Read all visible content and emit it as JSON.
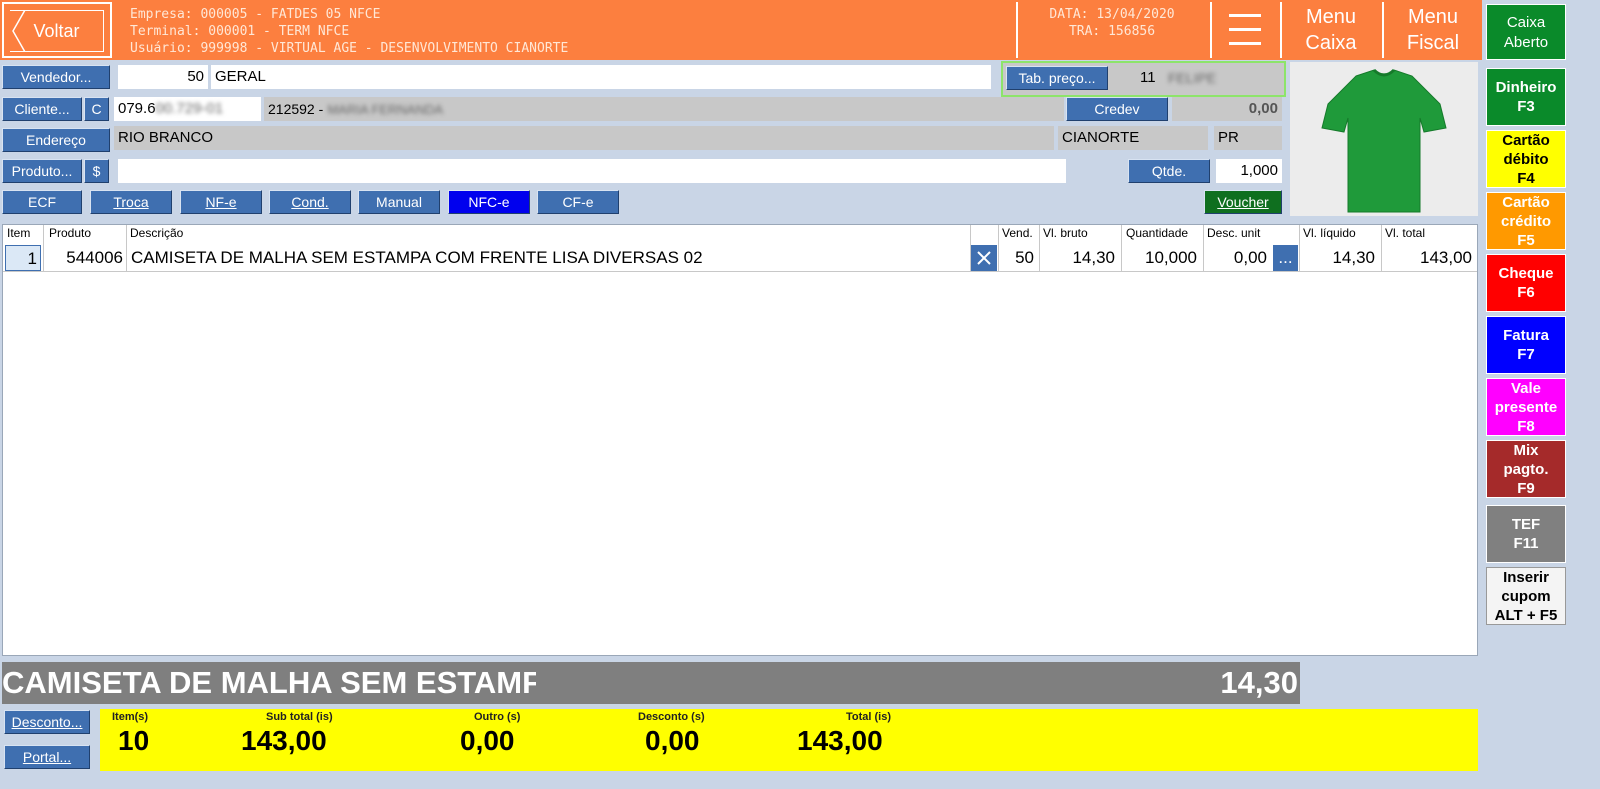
{
  "header": {
    "voltar": "Voltar",
    "empresa": "Empresa: 000005 - FATDES 05 NFCE",
    "terminal": "Terminal: 000001 - TERM NFCE",
    "usuario": "Usuário: 999998 - VIRTUAL AGE - DESENVOLVIMENTO CIANORTE",
    "data": "DATA: 13/04/2020",
    "tra": "TRA: 156856",
    "menu_caixa_1": "Menu",
    "menu_caixa_2": "Caixa",
    "menu_fiscal_1": "Menu",
    "menu_fiscal_2": "Fiscal",
    "caixa_1": "Caixa",
    "caixa_2": "Aberto"
  },
  "form": {
    "vendedor_btn": "Vendedor...",
    "vendedor_code": "50",
    "vendedor_name": "GERAL",
    "tab_preco_btn": "Tab. preço...",
    "tab_preco_code": "11",
    "tab_preco_name": "FELIPE",
    "cliente_btn": "Cliente...",
    "cliente_c_btn": "C",
    "cliente_doc": "079.6",
    "cliente_doc_blur": "00.729-01",
    "cliente_code": "212592 -",
    "cliente_name_blur": "MARIA FERNANDA",
    "credev_btn": "Credev",
    "credev_value": "0,00",
    "endereco_btn": "Endereço",
    "endereco": "RIO BRANCO",
    "cidade": "CIANORTE",
    "uf": "PR",
    "produto_btn": "Produto...",
    "produto_dollar_btn": "$",
    "produto_value": "",
    "qtde_btn": "Qtde.",
    "qtde_value": "1,000"
  },
  "modes": [
    "ECF",
    "Troca",
    "NF-e",
    "Cond.",
    "Manual",
    "NFC-e",
    "CF-e"
  ],
  "voucher_btn": "Voucher",
  "grid": {
    "headers": {
      "item": "Item",
      "produto": "Produto",
      "descricao": "Descrição",
      "vend": "Vend.",
      "vl_bruto": "Vl. bruto",
      "quantidade": "Quantidade",
      "desc_unit": "Desc. unit",
      "vl_liquido": "Vl. líquido",
      "vl_total": "Vl. total"
    },
    "rows": [
      {
        "item": "1",
        "produto": "544006",
        "descricao": "CAMISETA DE MALHA SEM ESTAMPA COM FRENTE LISA DIVERSAS 02",
        "vend": "50",
        "vl_bruto": "14,30",
        "quantidade": "10,000",
        "desc_unit": "0,00",
        "more": "...",
        "vl_liquido": "14,30",
        "vl_total": "143,00"
      }
    ]
  },
  "payments": [
    {
      "label1": "Dinheiro",
      "label2": "F3",
      "color": "#0a8a2a"
    },
    {
      "label1": "Cartão",
      "label2": "débito",
      "label3": "F4",
      "color": "#ffff00"
    },
    {
      "label1": "Cartão",
      "label2": "crédito",
      "label3": "F5",
      "color": "#ff9900"
    },
    {
      "label1": "Cheque",
      "label2": "F6",
      "color": "#ff0000"
    },
    {
      "label1": "Fatura",
      "label2": "F7",
      "color": "#0000ff"
    },
    {
      "label1": "Vale",
      "label2": "presente",
      "label3": "F8",
      "color": "#ff00ff"
    },
    {
      "label1": "Mix",
      "label2": "pagto.",
      "label3": "F9",
      "color": "#a52a2a"
    },
    {
      "label1": "TEF",
      "label2": "F11",
      "color": "#808080"
    },
    {
      "label1": "Inserir",
      "label2": "cupom",
      "label3": "ALT + F5",
      "color": "#f4f4f4"
    }
  ],
  "bottom": {
    "current_desc": "CAMISETA DE MALHA SEM ESTAMF",
    "current_price": "14,30",
    "desconto_btn": "Desconto...",
    "portal_btn": "Portal...",
    "items_label": "Item(s)",
    "items_value": "10",
    "subtotal_label": "Sub total (is)",
    "subtotal_value": "143,00",
    "outro_label": "Outro (s)",
    "outro_value": "0,00",
    "desconto_label": "Desconto (s)",
    "desconto_value": "0,00",
    "total_label": "Total (is)",
    "total_value": "143,00"
  }
}
